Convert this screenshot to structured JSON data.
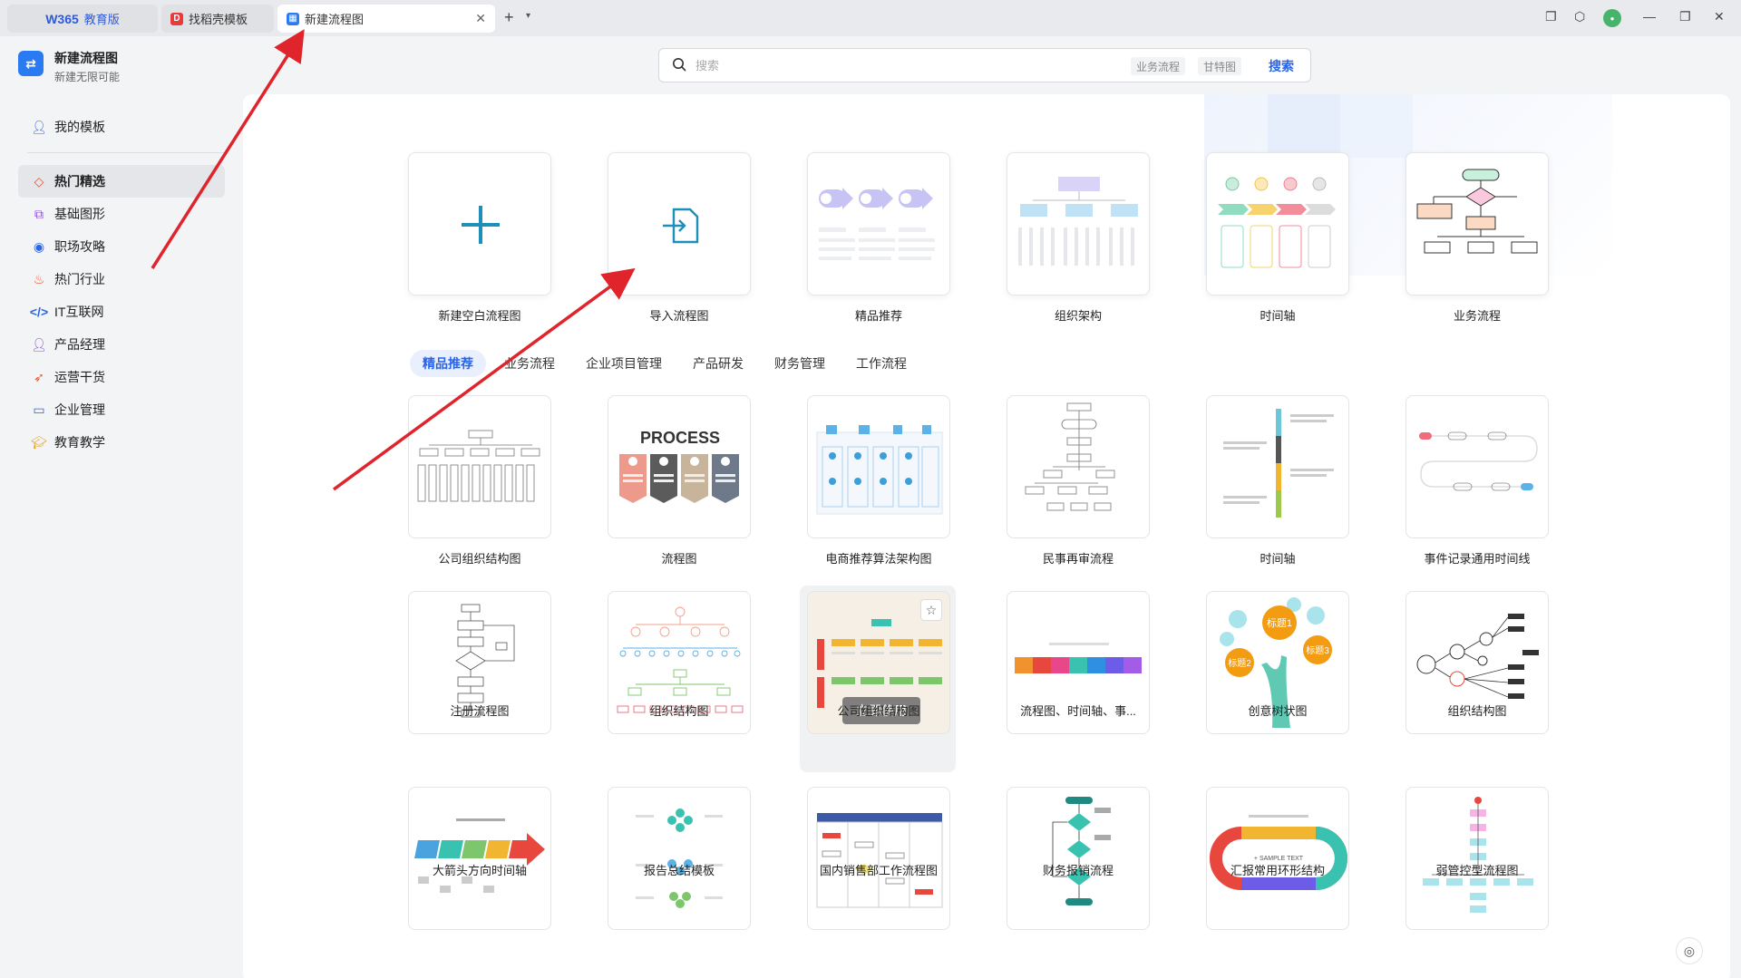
{
  "tabs": [
    {
      "logo": "W365",
      "label": "教育版"
    },
    {
      "label": "找稻壳模板"
    },
    {
      "label": "新建流程图"
    }
  ],
  "app": {
    "title": "新建流程图",
    "subtitle": "新建无限可能"
  },
  "sidebar": {
    "items": [
      {
        "label": "我的模板",
        "icon": "user-icon"
      },
      {
        "label": "热门精选",
        "icon": "gem-icon"
      },
      {
        "label": "基础图形",
        "icon": "shapes-icon"
      },
      {
        "label": "职场攻略",
        "icon": "person-circle-icon"
      },
      {
        "label": "热门行业",
        "icon": "flame-icon"
      },
      {
        "label": "IT互联网",
        "icon": "code-icon"
      },
      {
        "label": "产品经理",
        "icon": "user-icon"
      },
      {
        "label": "运营干货",
        "icon": "megaphone-icon"
      },
      {
        "label": "企业管理",
        "icon": "chat-icon"
      },
      {
        "label": "教育教学",
        "icon": "graduation-cap-icon"
      }
    ]
  },
  "search": {
    "placeholder": "搜索",
    "chips": [
      "业务流程",
      "甘特图"
    ],
    "button": "搜索"
  },
  "quick_cards": [
    {
      "label": "新建空白流程图"
    },
    {
      "label": "导入流程图"
    },
    {
      "label": "精品推荐"
    },
    {
      "label": "组织架构"
    },
    {
      "label": "时间轴"
    },
    {
      "label": "业务流程"
    }
  ],
  "categories": [
    "精品推荐",
    "业务流程",
    "企业项目管理",
    "产品研发",
    "财务管理",
    "工作流程"
  ],
  "templates_row1": [
    "公司组织结构图",
    "流程图",
    "电商推荐算法架构图",
    "民事再审流程",
    "时间轴",
    "事件记录通用时间线"
  ],
  "templates_row2": [
    "注册流程图",
    "组织结构图",
    "公司组织结构图",
    "流程图、时间轴、事...",
    "创意树状图",
    "组织结构图"
  ],
  "templates_row3": [
    "大箭头方向时间轴",
    "报告总结模板",
    "国内销售部工作流程图",
    "财务报销流程",
    "汇报常用环形结构",
    "弱管控型流程图"
  ],
  "thumb_text": {
    "process": "PROCESS",
    "tree_title1": "标题1",
    "tree_title2": "标题2",
    "tree_title3": "标题3",
    "ring_text": "+ SAMPLE TEXT"
  },
  "hover": {
    "use_label": "立即使用"
  },
  "colors": {
    "accent": "#2a65e8",
    "annotation_arrow": "#e0242b"
  }
}
